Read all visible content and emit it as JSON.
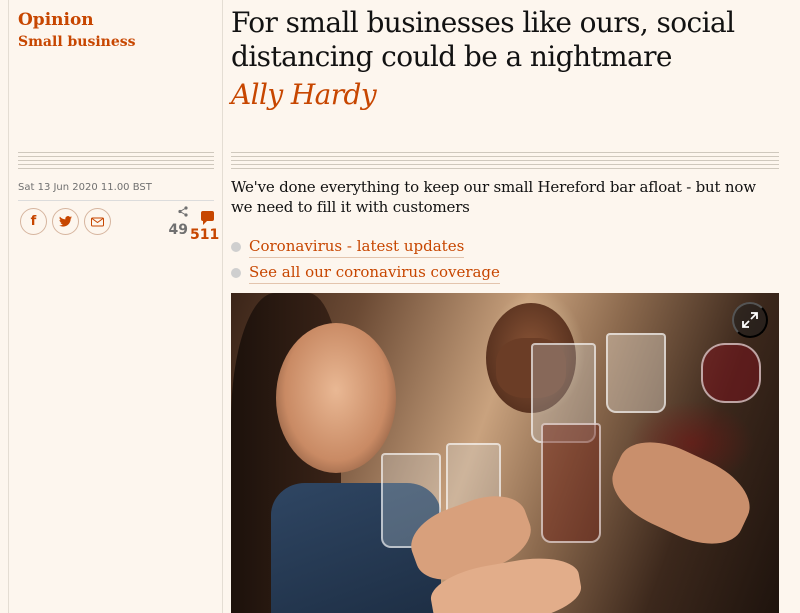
{
  "header": {
    "section": "Opinion",
    "series": "Small business"
  },
  "article": {
    "headline": "For small businesses like ours, social distancing could be a nightmare",
    "byline": "Ally Hardy",
    "dateline": "Sat 13 Jun 2020 11.00 BST",
    "standfirst": "We've done everything to keep our small Hereford bar afloat - but now we need to fill it with customers"
  },
  "share": {
    "buttons": [
      {
        "icon": "facebook-icon",
        "label": "f"
      },
      {
        "icon": "twitter-icon",
        "label": "t"
      },
      {
        "icon": "email-icon",
        "label": "✉"
      }
    ],
    "share_count": "49",
    "comment_count": "511"
  },
  "related_links": [
    {
      "text": "Coronavirus - latest updates"
    },
    {
      "text": "See all our coronavirus coverage"
    }
  ],
  "media": {
    "expand_icon": "expand-icon"
  },
  "colors": {
    "accent": "#c74600",
    "background": "#fdf6ee",
    "text": "#121212",
    "muted": "#707070"
  }
}
